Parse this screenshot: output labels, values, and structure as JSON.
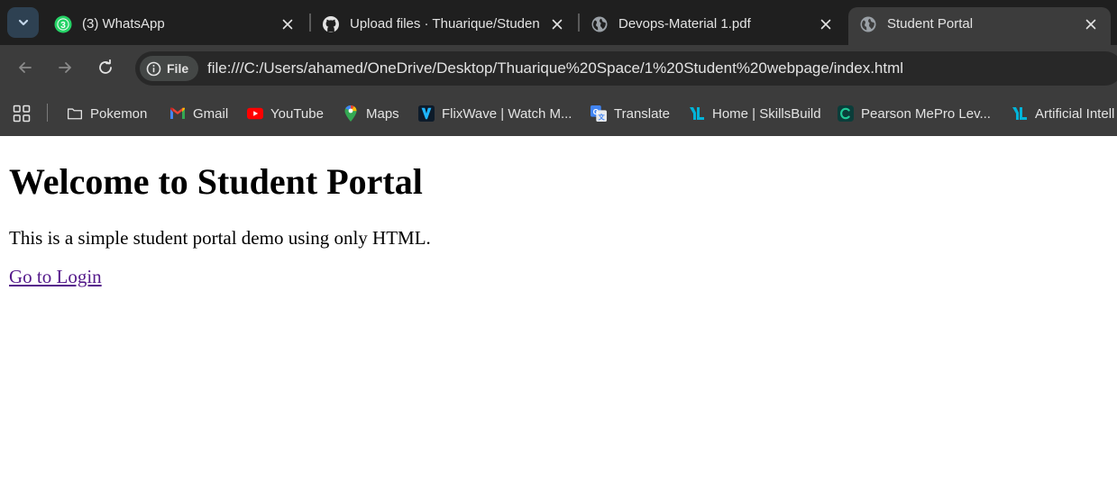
{
  "tabs": [
    {
      "title": "(3) WhatsApp",
      "icon": "whatsapp-icon",
      "badge": "3"
    },
    {
      "title": "Upload files · Thuarique/Studen",
      "icon": "github-icon"
    },
    {
      "title": "Devops-Material 1.pdf",
      "icon": "globe-icon"
    },
    {
      "title": "Student Portal",
      "icon": "globe-icon",
      "active": true
    }
  ],
  "toolbar": {
    "site_chip_label": "File",
    "url": "file:///C:/Users/ahamed/OneDrive/Desktop/Thuarique%20Space/1%20Student%20webpage/index.html"
  },
  "bookmarks": [
    {
      "label": "Pokemon",
      "icon": "folder-icon"
    },
    {
      "label": "Gmail",
      "icon": "gmail-icon"
    },
    {
      "label": "YouTube",
      "icon": "youtube-icon"
    },
    {
      "label": "Maps",
      "icon": "maps-icon"
    },
    {
      "label": "FlixWave | Watch M...",
      "icon": "flixwave-icon"
    },
    {
      "label": "Translate",
      "icon": "translate-icon"
    },
    {
      "label": "Home | SkillsBuild",
      "icon": "skillsbuild-icon"
    },
    {
      "label": "Pearson MePro Lev...",
      "icon": "pearson-icon"
    },
    {
      "label": "Artificial Intell",
      "icon": "skillsbuild-icon"
    }
  ],
  "page": {
    "heading": "Welcome to Student Portal",
    "intro": "This is a simple student portal demo using only HTML.",
    "link_label": "Go to Login"
  },
  "colors": {
    "tabstrip_bg": "#1f1f1f",
    "toolbar_bg": "#3c3c3c",
    "link_visited": "#551a8b"
  }
}
